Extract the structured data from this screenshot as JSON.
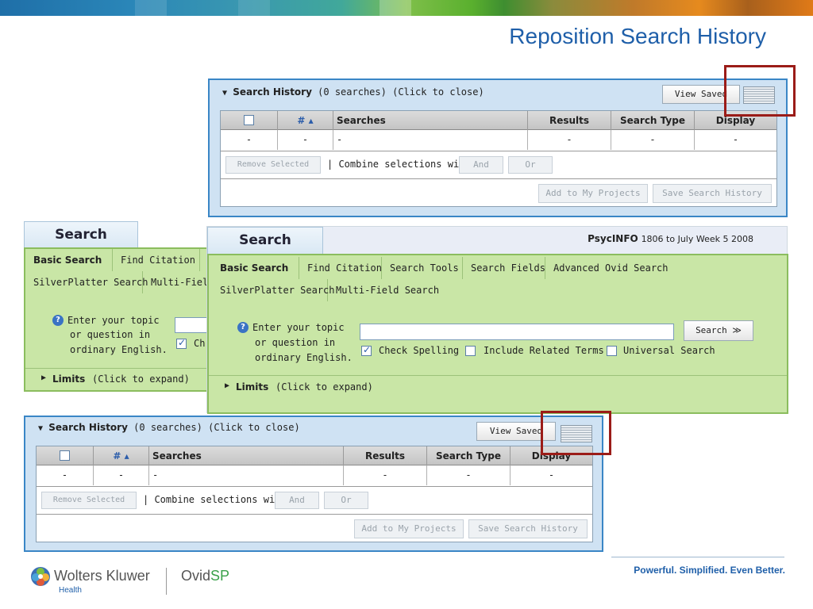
{
  "slide": {
    "title": "Reposition Search History",
    "tagline": "Powerful. Simplified. Even Better."
  },
  "branding": {
    "company": "Wolters Kluwer",
    "division": "Health",
    "product_prefix": "Ovid",
    "product_suffix": "SP"
  },
  "history_top": {
    "title": "Search History",
    "count_text": "(0 searches)",
    "hint": "(Click to close)",
    "view_saved": "View Saved",
    "columns": [
      "",
      "# ▴",
      "Searches",
      "Results",
      "Search Type",
      "Display"
    ],
    "row": [
      "-",
      "-",
      "-",
      "-",
      "-",
      "-"
    ],
    "remove_selected": "Remove Selected",
    "combine_label": "| Combine selections with:",
    "and": "And",
    "or": "Or",
    "add_projects": "Add to My Projects",
    "save_history": "Save Search History"
  },
  "history_bottom": {
    "title": "Search History",
    "count_text": "(0 searches)",
    "hint": "(Click to close)",
    "view_saved": "View Saved",
    "columns": [
      "",
      "# ▴",
      "Searches",
      "Results",
      "Search Type",
      "Display"
    ],
    "row": [
      "-",
      "-",
      "-",
      "-",
      "-",
      "-"
    ],
    "remove_selected": "Remove Selected",
    "combine_label": "| Combine selections with:",
    "and": "And",
    "or": "Or",
    "add_projects": "Add to My Projects",
    "save_history": "Save Search History"
  },
  "search_back": {
    "tab": "Search",
    "tabs_row1": [
      "Basic Search",
      "Find Citation"
    ],
    "tabs_row2": [
      "SilverPlatter Search",
      "Multi-Field"
    ],
    "prompt": [
      "Enter your topic",
      "or question in",
      "ordinary English."
    ],
    "check_partial": "Ch",
    "limits": "Limits",
    "limits_hint": "(Click to expand)"
  },
  "search_front": {
    "tab": "Search",
    "database_name": "PsycINFO",
    "database_range": "1806 to July Week 5 2008",
    "tabs_row1": [
      "Basic Search",
      "Find Citation",
      "Search Tools",
      "Search Fields",
      "Advanced Ovid Search"
    ],
    "tabs_row2": [
      "SilverPlatter Search",
      "Multi-Field Search"
    ],
    "prompt": [
      "Enter your topic",
      "or question in",
      "ordinary English."
    ],
    "query_value": "",
    "search_button": "Search ≫",
    "options": [
      {
        "label": "Check Spelling",
        "checked": true
      },
      {
        "label": "Include Related Terms",
        "checked": false
      },
      {
        "label": "Universal Search",
        "checked": false
      }
    ],
    "limits": "Limits",
    "limits_hint": "(Click to expand)"
  },
  "colors": {
    "accent": "#1f5fa9",
    "highlight_box": "#9b1c18",
    "search_green": "#c9e6a6",
    "history_blue": "#cfe2f3"
  }
}
